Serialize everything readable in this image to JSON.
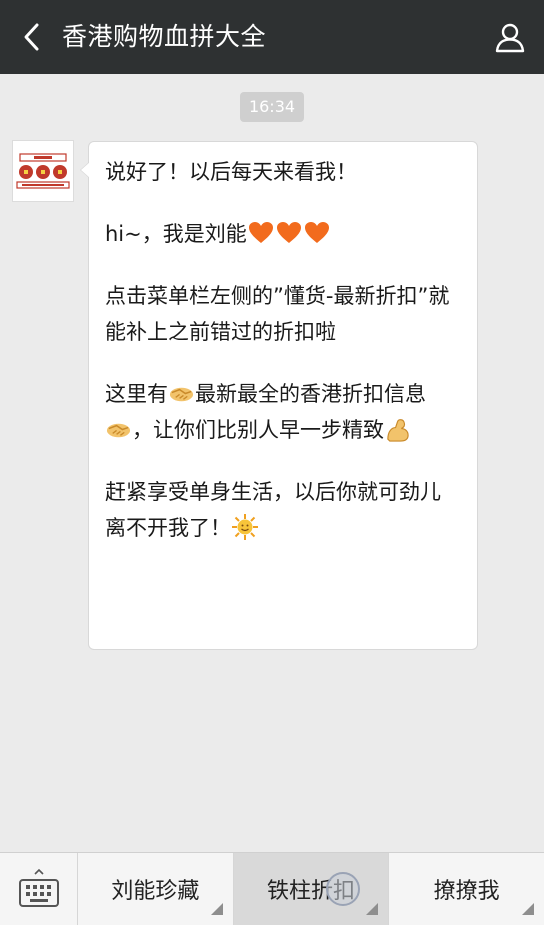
{
  "header": {
    "title": "香港购物血拼大全",
    "back_icon": "chevron-left-icon",
    "profile_icon": "person-icon",
    "background": "#2e3132"
  },
  "timestamp": "16:34",
  "message": {
    "avatar_icon": "account-logo",
    "paragraphs": [
      "说好了！以后每天来看我！",
      "hi~，我是刘能",
      "点击菜单栏左侧的”懂货-最新折扣”就能补上之前错过的折扣啦",
      "这里有",
      "最新最全的香港折扣信息",
      "，让你们比别人早一步精致",
      "赶紧享受单身生活，以后你就可劲儿离不开我了！"
    ]
  },
  "menu": {
    "keyboard_icon": "keyboard-icon",
    "items": [
      {
        "label": "刘能珍藏"
      },
      {
        "label": "铁柱折扣"
      },
      {
        "label": "撩撩我"
      }
    ]
  }
}
